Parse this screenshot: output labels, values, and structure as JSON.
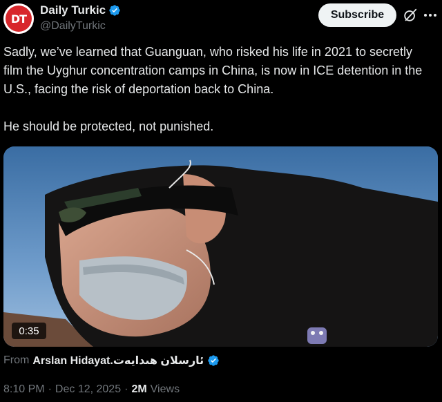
{
  "header": {
    "avatar_text": "DT",
    "display_name": "Daily Turkic",
    "handle": "@DailyTurkic",
    "subscribe_label": "Subscribe"
  },
  "post": {
    "paragraphs": [
      "Sadly, we’ve learned that Guanguan, who risked his life in 2021 to secretly film the Uyghur concentration camps in China, is now in ICE detention in the U.S., facing the risk of deportation back to China.",
      "He should be protected, not punished."
    ]
  },
  "media": {
    "duration": "0:35"
  },
  "attribution": {
    "from_label": "From",
    "user": "Arslan Hidayat.ئارسلان ھىدايەت"
  },
  "meta": {
    "time": "8:10 PM",
    "separator": "·",
    "date": "Dec 12, 2025",
    "views_count": "2M",
    "views_label": "Views"
  },
  "colors": {
    "background": "#000000",
    "text": "#e7e9ea",
    "muted": "#71767b",
    "verified": "#1d9bf0",
    "avatar": "#d8262b"
  },
  "icons": [
    "verified-badge-icon",
    "grok-icon",
    "more-icon"
  ]
}
